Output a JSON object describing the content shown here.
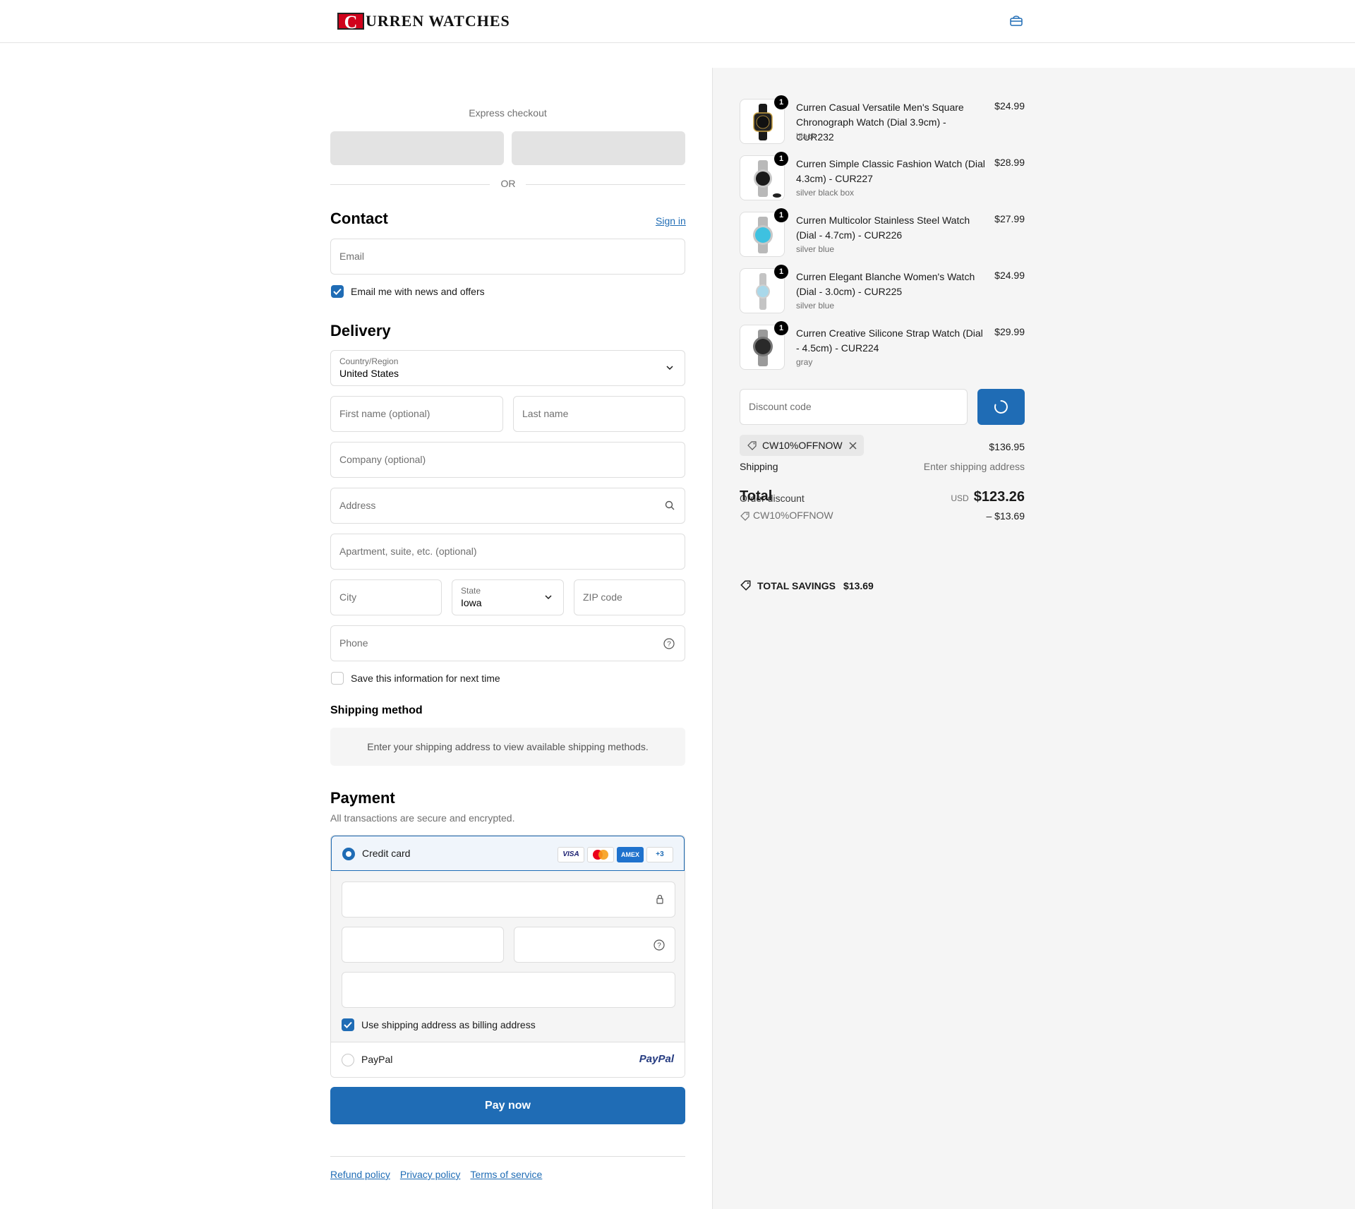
{
  "header": {
    "logo_letter": "C",
    "logo_text": "URREN WATCHES",
    "cart_icon": "shopping-bag-icon"
  },
  "express": {
    "title": "Express checkout",
    "or_label": "OR"
  },
  "contact": {
    "heading": "Contact",
    "sign_in": "Sign in",
    "email_placeholder": "Email",
    "newsletter_label": "Email me with news and offers",
    "newsletter_checked": true
  },
  "delivery": {
    "heading": "Delivery",
    "country_label": "Country/Region",
    "country_value": "United States",
    "first_name_placeholder": "First name (optional)",
    "last_name_placeholder": "Last name",
    "company_placeholder": "Company (optional)",
    "address_placeholder": "Address",
    "apartment_placeholder": "Apartment, suite, etc. (optional)",
    "city_placeholder": "City",
    "state_label": "State",
    "state_value": "Iowa",
    "zip_placeholder": "ZIP code",
    "phone_placeholder": "Phone",
    "save_info_label": "Save this information for next time",
    "save_info_checked": false
  },
  "shipping_method": {
    "heading": "Shipping method",
    "message": "Enter your shipping address to view available shipping methods."
  },
  "payment": {
    "heading": "Payment",
    "subtitle": "All transactions are secure and encrypted.",
    "credit_card_label": "Credit card",
    "card_logos": [
      "VISA",
      "",
      "AMEX",
      "+3"
    ],
    "billing_label": "Use shipping address as billing address",
    "billing_checked": true,
    "paypal_label": "PayPal",
    "paypal_logo": "PayPal",
    "pay_button": "Pay now"
  },
  "footer": {
    "links": [
      "Refund policy",
      "Privacy policy",
      "Terms of service"
    ]
  },
  "order": {
    "items": [
      {
        "name": "Curren Casual Versatile Men's Square Chronograph Watch (Dial 3.9cm) - CUR232",
        "variant": "black",
        "price": "$24.99",
        "qty": "1"
      },
      {
        "name": "Curren Simple Classic Fashion Watch (Dial 4.3cm) - CUR227",
        "variant": "silver black box",
        "price": "$28.99",
        "qty": "1"
      },
      {
        "name": "Curren Multicolor Stainless Steel Watch (Dial - 4.7cm) - CUR226",
        "variant": "silver blue",
        "price": "$27.99",
        "qty": "1"
      },
      {
        "name": "Curren Elegant Blanche Women's Watch (Dial - 3.0cm) - CUR225",
        "variant": "silver blue",
        "price": "$24.99",
        "qty": "1"
      },
      {
        "name": "Curren Creative Silicone Strap Watch (Dial - 4.5cm) - CUR224",
        "variant": "gray",
        "price": "$29.99",
        "qty": "1"
      }
    ],
    "discount_placeholder": "Discount code",
    "applied_code": "CW10%OFFNOW",
    "subtotal_value": "$136.95",
    "shipping_label": "Shipping",
    "shipping_value": "Enter shipping address",
    "total_label": "Total",
    "order_discount_label": "Order discount",
    "currency": "USD",
    "total_value": "$123.26",
    "discount_code_line": "CW10%OFFNOW",
    "discount_amount": "– $13.69",
    "savings_label": "TOTAL SAVINGS",
    "savings_value": "$13.69"
  },
  "colors": {
    "accent": "#1f6cb5",
    "brand_red": "#d0021b",
    "sidebar_bg": "#f5f5f5"
  }
}
